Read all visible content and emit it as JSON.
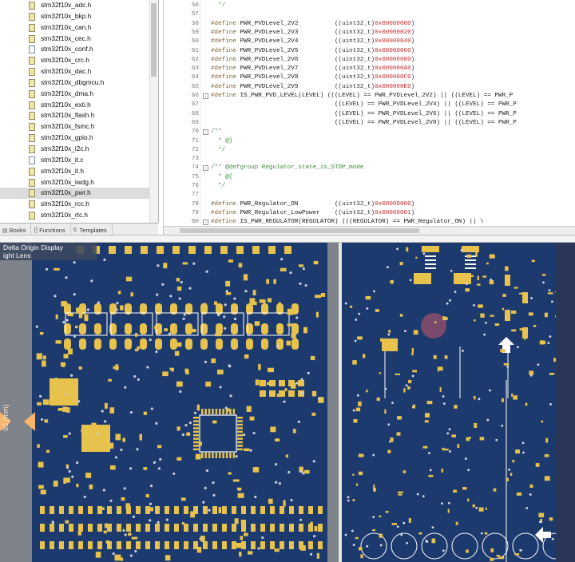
{
  "file_tree": {
    "files": [
      {
        "name": "stm32f10x_adc.h",
        "kind": "h"
      },
      {
        "name": "stm32f10x_bkp.h",
        "kind": "h"
      },
      {
        "name": "stm32f10x_can.h",
        "kind": "h"
      },
      {
        "name": "stm32f10x_cec.h",
        "kind": "h"
      },
      {
        "name": "stm32f10x_conf.h",
        "kind": "c"
      },
      {
        "name": "stm32f10x_crc.h",
        "kind": "h"
      },
      {
        "name": "stm32f10x_dac.h",
        "kind": "h"
      },
      {
        "name": "stm32f10x_dbgmcu.h",
        "kind": "h"
      },
      {
        "name": "stm32f10x_dma.h",
        "kind": "h"
      },
      {
        "name": "stm32f10x_exti.h",
        "kind": "h"
      },
      {
        "name": "stm32f10x_flash.h",
        "kind": "h"
      },
      {
        "name": "stm32f10x_fsmc.h",
        "kind": "h"
      },
      {
        "name": "stm32f10x_gpio.h",
        "kind": "h"
      },
      {
        "name": "stm32f10x_i2c.h",
        "kind": "h"
      },
      {
        "name": "stm32f10x_it.c",
        "kind": "c"
      },
      {
        "name": "stm32f10x_it.h",
        "kind": "h"
      },
      {
        "name": "stm32f10x_iwdg.h",
        "kind": "h"
      },
      {
        "name": "stm32f10x_pwr.h",
        "kind": "h",
        "selected": true
      },
      {
        "name": "stm32f10x_rcc.h",
        "kind": "h"
      },
      {
        "name": "stm32f10x_rtc.h",
        "kind": "h"
      }
    ],
    "tabs": [
      {
        "label": "Books",
        "icon": "books-icon"
      },
      {
        "label": "Functions",
        "icon": "functions-icon"
      },
      {
        "label": "Templates",
        "icon": "templates-icon"
      }
    ]
  },
  "editor": {
    "lines": [
      {
        "num": "56",
        "tokens": [
          {
            "t": "  */",
            "c": "cmt"
          }
        ]
      },
      {
        "num": "57",
        "tokens": []
      },
      {
        "num": "58",
        "tokens": [
          {
            "t": "#define ",
            "c": "dir"
          },
          {
            "t": "PWR_PVDLevel_2V2          ",
            "c": "name"
          },
          {
            "t": "((uint32_t)",
            "c": "type"
          },
          {
            "t": "0x00000000",
            "c": "hex"
          },
          {
            "t": ")",
            "c": "type"
          }
        ]
      },
      {
        "num": "59",
        "tokens": [
          {
            "t": "#define ",
            "c": "dir"
          },
          {
            "t": "PWR_PVDLevel_2V3          ",
            "c": "name"
          },
          {
            "t": "((uint32_t)",
            "c": "type"
          },
          {
            "t": "0x00000020",
            "c": "hex"
          },
          {
            "t": ")",
            "c": "type"
          }
        ]
      },
      {
        "num": "60",
        "tokens": [
          {
            "t": "#define ",
            "c": "dir"
          },
          {
            "t": "PWR_PVDLevel_2V4          ",
            "c": "name"
          },
          {
            "t": "((uint32_t)",
            "c": "type"
          },
          {
            "t": "0x00000040",
            "c": "hex"
          },
          {
            "t": ")",
            "c": "type"
          }
        ]
      },
      {
        "num": "61",
        "tokens": [
          {
            "t": "#define ",
            "c": "dir"
          },
          {
            "t": "PWR_PVDLevel_2V5          ",
            "c": "name"
          },
          {
            "t": "((uint32_t)",
            "c": "type"
          },
          {
            "t": "0x00000060",
            "c": "hex"
          },
          {
            "t": ")",
            "c": "type"
          }
        ]
      },
      {
        "num": "62",
        "tokens": [
          {
            "t": "#define ",
            "c": "dir"
          },
          {
            "t": "PWR_PVDLevel_2V6          ",
            "c": "name"
          },
          {
            "t": "((uint32_t)",
            "c": "type"
          },
          {
            "t": "0x00000080",
            "c": "hex"
          },
          {
            "t": ")",
            "c": "type"
          }
        ]
      },
      {
        "num": "63",
        "tokens": [
          {
            "t": "#define ",
            "c": "dir"
          },
          {
            "t": "PWR_PVDLevel_2V7          ",
            "c": "name"
          },
          {
            "t": "((uint32_t)",
            "c": "type"
          },
          {
            "t": "0x000000A0",
            "c": "hex"
          },
          {
            "t": ")",
            "c": "type"
          }
        ]
      },
      {
        "num": "64",
        "tokens": [
          {
            "t": "#define ",
            "c": "dir"
          },
          {
            "t": "PWR_PVDLevel_2V8          ",
            "c": "name"
          },
          {
            "t": "((uint32_t)",
            "c": "type"
          },
          {
            "t": "0x000000C0",
            "c": "hex"
          },
          {
            "t": ")",
            "c": "type"
          }
        ]
      },
      {
        "num": "65",
        "tokens": [
          {
            "t": "#define ",
            "c": "dir"
          },
          {
            "t": "PWR_PVDLevel_2V9          ",
            "c": "name"
          },
          {
            "t": "((uint32_t)",
            "c": "type"
          },
          {
            "t": "0x000000E0",
            "c": "hex"
          },
          {
            "t": ")",
            "c": "type"
          }
        ]
      },
      {
        "num": "66",
        "fold": "-",
        "tokens": [
          {
            "t": "#define ",
            "c": "dir"
          },
          {
            "t": "IS_PWR_PVD_LEVEL(LEVEL) (((LEVEL) == PWR_PVDLevel_2V2) || ((LEVEL) == PWR_P",
            "c": "plain"
          }
        ]
      },
      {
        "num": "67",
        "tokens": [
          {
            "t": "                                  ((LEVEL) == PWR_PVDLevel_2V4) || ((LEVEL) == PWR_P",
            "c": "plain"
          }
        ]
      },
      {
        "num": "68",
        "tokens": [
          {
            "t": "                                  ((LEVEL) == PWR_PVDLevel_2V6) || ((LEVEL) == PWR_P",
            "c": "plain"
          }
        ]
      },
      {
        "num": "69",
        "tokens": [
          {
            "t": "                                  ((LEVEL) == PWR_PVDLevel_2V8) || ((LEVEL) == PWR_P",
            "c": "plain"
          }
        ]
      },
      {
        "num": "70",
        "fold": "-",
        "tokens": [
          {
            "t": "/**",
            "c": "cmt"
          }
        ]
      },
      {
        "num": "71",
        "tokens": [
          {
            "t": "  * @}",
            "c": "cmt"
          }
        ]
      },
      {
        "num": "72",
        "tokens": [
          {
            "t": "  */",
            "c": "cmt"
          }
        ]
      },
      {
        "num": "73",
        "tokens": []
      },
      {
        "num": "74",
        "fold": "-",
        "tokens": [
          {
            "t": "/** @defgroup Regulator_state_is_STOP_mode",
            "c": "cmt"
          }
        ]
      },
      {
        "num": "75",
        "tokens": [
          {
            "t": "  * @{",
            "c": "cmt"
          }
        ]
      },
      {
        "num": "76",
        "tokens": [
          {
            "t": "  */",
            "c": "cmt"
          }
        ]
      },
      {
        "num": "77",
        "tokens": []
      },
      {
        "num": "78",
        "tokens": [
          {
            "t": "#define ",
            "c": "dir"
          },
          {
            "t": "PWR_Regulator_ON          ",
            "c": "name"
          },
          {
            "t": "((uint32_t)",
            "c": "type"
          },
          {
            "t": "0x00000000",
            "c": "hex"
          },
          {
            "t": ")",
            "c": "type"
          }
        ]
      },
      {
        "num": "79",
        "tokens": [
          {
            "t": "#define ",
            "c": "dir"
          },
          {
            "t": "PWR_Regulator_LowPower    ",
            "c": "name"
          },
          {
            "t": "((uint32_t)",
            "c": "type"
          },
          {
            "t": "0x00000001",
            "c": "hex"
          },
          {
            "t": ")",
            "c": "type"
          }
        ]
      },
      {
        "num": "80",
        "fold": "-",
        "tokens": [
          {
            "t": "#define ",
            "c": "dir"
          },
          {
            "t": "IS_PWR_REGULATOR(REGULATOR) (((REGULATOR) == PWR_Regulator_ON) || \\",
            "c": "plain"
          }
        ]
      }
    ]
  },
  "pcb_view": {
    "overlay_lines": [
      "Delta Origin Display",
      "ight Lens"
    ],
    "ruler_label": "95 (mm)",
    "colors": {
      "board": "#1d3a6e",
      "pad": "#e7c34e",
      "silk": "#ffffff",
      "frame": "#7d8389"
    }
  }
}
